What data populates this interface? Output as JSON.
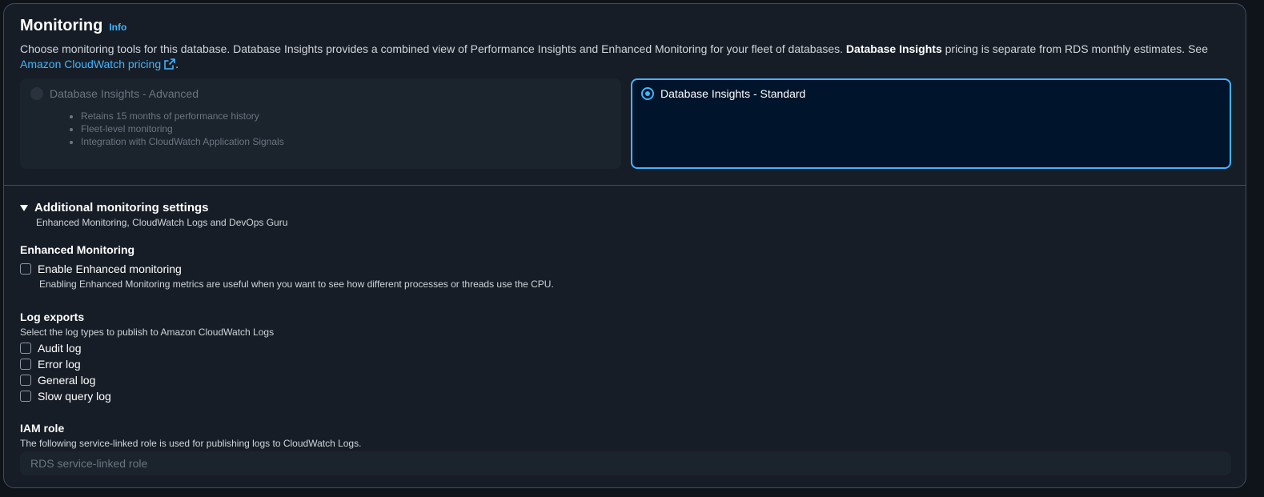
{
  "header": {
    "title": "Monitoring",
    "info": "Info",
    "desc_part1": "Choose monitoring tools for this database. Database Insights provides a combined view of Performance Insights and Enhanced Monitoring for your fleet of databases. ",
    "desc_bold": "Database Insights",
    "desc_part2": " pricing is separate from RDS monthly estimates. See",
    "pricing_link": "Amazon CloudWatch pricing",
    "desc_end": "."
  },
  "tiles": {
    "advanced": {
      "label": "Database Insights - Advanced",
      "bullets": [
        "Retains 15 months of performance history",
        "Fleet-level monitoring",
        "Integration with CloudWatch Application Signals"
      ]
    },
    "standard": {
      "label": "Database Insights - Standard"
    }
  },
  "additional": {
    "title": "Additional monitoring settings",
    "subtitle": "Enhanced Monitoring, CloudWatch Logs and DevOps Guru"
  },
  "enhanced": {
    "label": "Enhanced Monitoring",
    "checkbox_label": "Enable Enhanced monitoring",
    "help": "Enabling Enhanced Monitoring metrics are useful when you want to see how different processes or threads use the CPU."
  },
  "logs": {
    "label": "Log exports",
    "desc": "Select the log types to publish to Amazon CloudWatch Logs",
    "items": [
      "Audit log",
      "Error log",
      "General log",
      "Slow query log"
    ]
  },
  "iam": {
    "label": "IAM role",
    "desc": "The following service-linked role is used for publishing logs to CloudWatch Logs.",
    "value": "RDS service-linked role"
  },
  "colors": {
    "accent": "#42b4ff",
    "selected_bg": "#00142b",
    "panel_bg": "#161d26"
  }
}
